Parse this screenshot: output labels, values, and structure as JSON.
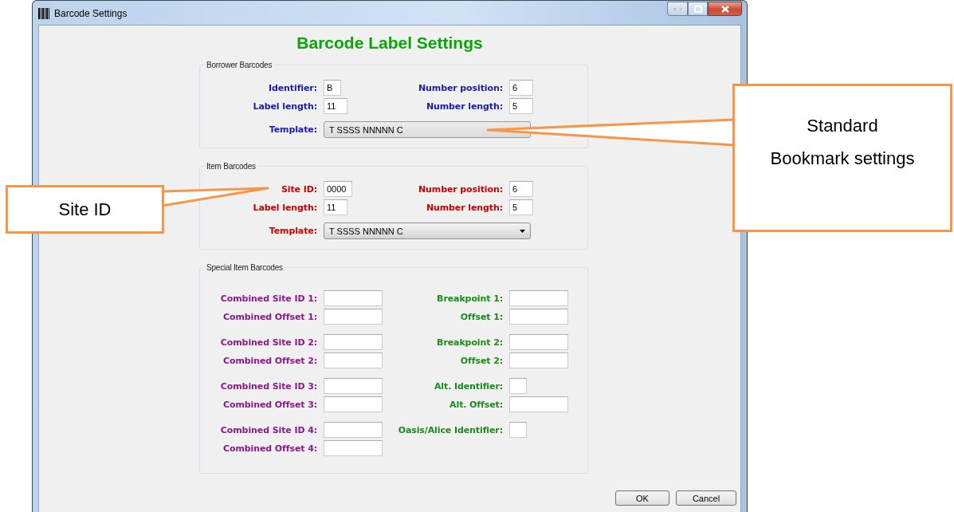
{
  "window": {
    "title": "Barcode Settings"
  },
  "heading": "Barcode Label Settings",
  "sections": [
    {
      "title": "Borrower Barcodes",
      "color": "#1c1caa",
      "rows": [
        [
          {
            "label": "Identifier:",
            "value": "B",
            "kind": "tiny"
          },
          {
            "label": "Number position:",
            "value": "6",
            "kind": "short"
          }
        ],
        [
          {
            "label": "Label length:",
            "value": "11",
            "kind": "short"
          },
          {
            "label": "Number length:",
            "value": "5",
            "kind": "short"
          }
        ]
      ],
      "template": {
        "label": "Template:",
        "value": "T SSSS NNNNN C",
        "disabled": true
      }
    },
    {
      "title": "Item Barcodes",
      "color": "#cc0000",
      "rows": [
        [
          {
            "label": "Site ID:",
            "value": "0000",
            "kind": "medium"
          },
          {
            "label": "Number position:",
            "value": "6",
            "kind": "short"
          }
        ],
        [
          {
            "label": "Label length:",
            "value": "11",
            "kind": "short"
          },
          {
            "label": "Number length:",
            "value": "5",
            "kind": "short"
          }
        ]
      ],
      "template": {
        "label": "Template:",
        "value": "T SSSS NNNNN C",
        "disabled": false
      }
    }
  ],
  "special": {
    "title": "Special Item Barcodes",
    "columns": [
      {
        "color": "#8a1a8a"
      },
      {
        "color": "#1a8a1a"
      }
    ],
    "blocks": [
      [
        [
          {
            "label": "Combined Site ID 1:",
            "kind": "long"
          },
          {
            "label": "Breakpoint 1:",
            "kind": "long"
          }
        ],
        [
          {
            "label": "Combined Offset 1:",
            "kind": "long"
          },
          {
            "label": "Offset 1:",
            "kind": "long"
          }
        ]
      ],
      [
        [
          {
            "label": "Combined Site ID 2:",
            "kind": "long"
          },
          {
            "label": "Breakpoint 2:",
            "kind": "long"
          }
        ],
        [
          {
            "label": "Combined Offset 2:",
            "kind": "long"
          },
          {
            "label": "Offset 2:",
            "kind": "long"
          }
        ]
      ],
      [
        [
          {
            "label": "Combined Site ID 3:",
            "kind": "long"
          },
          {
            "label": "Alt. Identifier:",
            "kind": "tiny"
          }
        ],
        [
          {
            "label": "Combined Offset 3:",
            "kind": "long"
          },
          {
            "label": "Alt. Offset:",
            "kind": "long"
          }
        ]
      ],
      [
        [
          {
            "label": "Combined Site ID 4:",
            "kind": "long"
          },
          {
            "label": "Oasis/Alice Identifier:",
            "kind": "tiny"
          }
        ],
        [
          {
            "label": "Combined Offset 4:",
            "kind": "long"
          }
        ]
      ]
    ]
  },
  "buttons": [
    "OK",
    "Cancel"
  ],
  "callouts": [
    {
      "kind": "right",
      "text": "Standard\nBookmark settings"
    },
    {
      "kind": "left",
      "text": "Site ID"
    }
  ]
}
